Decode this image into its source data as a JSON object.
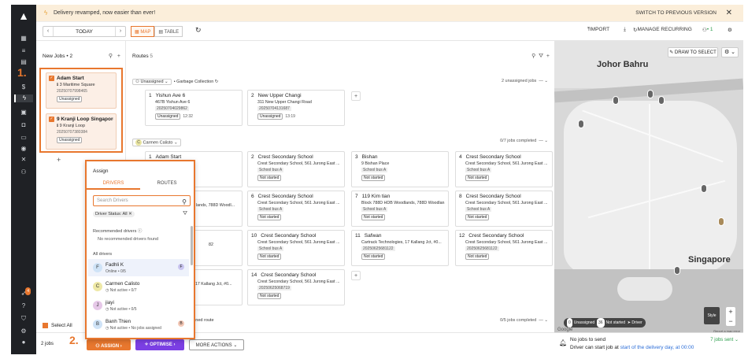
{
  "banner": {
    "text": "Delivery revamped, now easier than ever!",
    "switch": "SWITCH TO PREVIOUS VERSION"
  },
  "toolbar": {
    "date": "TODAY",
    "map_label": "MAP",
    "table_label": "TABLE",
    "import": "IMPORT",
    "manage_recurring": "MANAGE RECURRING",
    "user_count": "• 1"
  },
  "annotations": {
    "step1": "1.",
    "step2": "2."
  },
  "nav_badge": "4",
  "new_jobs": {
    "title": "New Jobs",
    "count": "• 2",
    "jobs": [
      {
        "title": "Adam Start",
        "address": "3 Maritime Square",
        "code": "20250707998465",
        "status": "Unassigned"
      },
      {
        "title": "9 Kranji Loop Singapore 7...",
        "address": "9 Kranji Loop",
        "code": "20250707380384",
        "status": "Unassigned"
      }
    ],
    "select_all": "Select All",
    "jobs_count": "2 jobs"
  },
  "routes": {
    "title": "Routes",
    "count": "5",
    "unassigned_route": {
      "dropdown": "Unassigned",
      "type": "Garbage Collection",
      "summary": "2 unassigned jobs",
      "stops": [
        {
          "num": "1",
          "title": "Yishun Ave 6",
          "address": "467B Yishun Ave 6",
          "code": "20250704029862",
          "status": "Unassigned",
          "eta": "12:32"
        },
        {
          "num": "2",
          "title": "New Upper Changi",
          "address": "311 New Upper Changi Road",
          "code": "20250704131687",
          "status": "Unassigned",
          "eta": "13:19"
        }
      ]
    },
    "driver_route": {
      "driver": "Carmen Calisto",
      "avatar": "C",
      "summary": "0/7 jobs completed",
      "stops": [
        {
          "num": "1",
          "title": "Adam Start",
          "address": "",
          "sub": "",
          "status": ""
        },
        {
          "num": "2",
          "title": "Crest Secondary School",
          "address": "Crest Secondary School, 561 Jurong East ...",
          "sub": "School bus A",
          "status": "Not started"
        },
        {
          "num": "3",
          "title": "Bishan",
          "address": "9 Bishan Place",
          "sub": "School bus A",
          "status": "Not started"
        },
        {
          "num": "4",
          "title": "Crest Secondary School",
          "address": "Crest Secondary School, 561 Jurong East ...",
          "sub": "School bus A",
          "status": "Not started"
        },
        {
          "num": "6",
          "title": "Crest Secondary School",
          "address": "Crest Secondary School, 561 Jurong East ...",
          "sub": "School bus A",
          "status": "Not started"
        },
        {
          "num": "7",
          "title": "119 Kim tian",
          "address": "Block 788D HDB Woodlands, 788D Woodlan...",
          "sub": "School bus A",
          "status": "Not started"
        },
        {
          "num": "8",
          "title": "Crest Secondary School",
          "address": "Crest Secondary School, 561 Jurong East ...",
          "sub": "School bus A",
          "status": "Not started"
        },
        {
          "num": "10",
          "title": "Crest Secondary School",
          "address": "Crest Secondary School, 561 Jurong East ...",
          "sub": "School bus A",
          "status": "Not started"
        },
        {
          "num": "11",
          "title": "Safwan",
          "address": "Cartrack Technologies, 17 Kallang Jct, #0...",
          "sub": "20250625681122",
          "status": "Not started"
        },
        {
          "num": "12",
          "title": "Crest Secondary School",
          "address": "Crest Secondary School, 561 Jurong East ...",
          "sub": "20250625681122",
          "status": "Not started"
        },
        {
          "num": "14",
          "title": "Crest Secondary School",
          "address": "Crest Secondary School, 561 Jurong East ...",
          "sub": "20250625068719",
          "status": "Not started"
        }
      ],
      "partial_behind": [
        "lands, 788D Woodl...",
        "82",
        ", 17 Kallang Jct, #0..."
      ]
    },
    "last_route": {
      "label": "igned route",
      "summary": "0/5 jobs completed"
    }
  },
  "assign_popup": {
    "title": "Assign",
    "tab_drivers": "DRIVERS",
    "tab_routes": "ROUTES",
    "search_placeholder": "Search Drivers",
    "filter": "Driver Status: All",
    "recommended_label": "Recommended drivers",
    "recommended_empty": "No recommended drivers found",
    "all_drivers_label": "All drivers",
    "drivers": [
      {
        "initial": "F",
        "name": "Fadhli K",
        "status": "Online • 0/5",
        "tag": "F",
        "color": "#cfe3f7",
        "tag_color": "#c9c5f0"
      },
      {
        "initial": "C",
        "name": "Carmen Calisto",
        "status": "Not active • 0/7",
        "tag": "",
        "color": "#eee8a6",
        "tag_color": ""
      },
      {
        "initial": "J",
        "name": "jiayi",
        "status": "Not active • 0/5",
        "tag": "",
        "color": "#e6c8e8",
        "tag_color": ""
      },
      {
        "initial": "B",
        "name": "Banh Thien",
        "status": "Not active • No jobs assigned",
        "tag": "B",
        "color": "#cfe3f7",
        "tag_color": "#f3c7b5"
      }
    ]
  },
  "bottom": {
    "assign": "ASSIGN",
    "optimise": "OPTIMISE",
    "more": "MORE ACTIONS"
  },
  "map": {
    "draw_label": "DRAW TO SELECT",
    "label_johor": "Johor Bahru",
    "label_singapore": "Singapore",
    "legend_unassigned_n": "0",
    "legend_unassigned": "Unassigned",
    "legend_notstarted_n": "36",
    "legend_notstarted": "Not started",
    "legend_driver": "Driver",
    "style": "Style",
    "google": "Google",
    "report": "Report a map error",
    "foot_l1": "No jobs to send",
    "foot_l2a": "Driver can start job at ",
    "foot_l2b": "start of the delivery day, at 00:00",
    "sent": "7 jobs sent"
  }
}
